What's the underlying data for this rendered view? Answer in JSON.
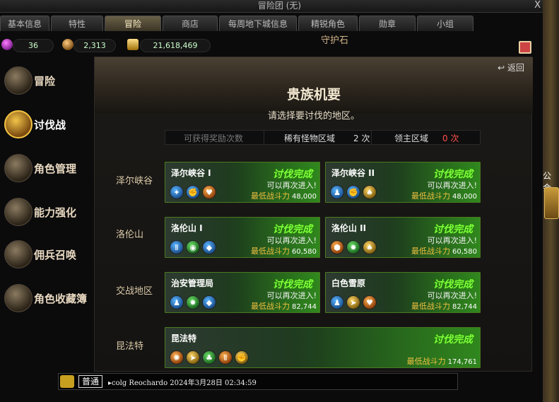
{
  "window": {
    "title": "冒险团 (无)",
    "close": "X"
  },
  "tabs": [
    "基本信息",
    "特性",
    "冒险",
    "商店",
    "每周地下城信息",
    "精锐角色",
    "勋章",
    "小组"
  ],
  "active_tab": 2,
  "currency": {
    "gems": "36",
    "coins": "2,313",
    "gold": "21,618,469"
  },
  "guardian_text": "守护石",
  "sidebar": [
    {
      "label": "冒险"
    },
    {
      "label": "讨伐战"
    },
    {
      "label": "角色管理"
    },
    {
      "label": "能力强化"
    },
    {
      "label": "佣兵召唤"
    },
    {
      "label": "角色收藏簿"
    }
  ],
  "right_strip_text": "公会",
  "main": {
    "back": "返回",
    "title": "贵族机要",
    "subtitle": "请选择要讨伐的地区。",
    "stats": {
      "reward_label": "可获得奖励次数",
      "rare_label": "稀有怪物区域",
      "rare_count": "2 次",
      "boss_label": "领主区域",
      "boss_count": "0 次"
    },
    "regions": [
      {
        "name": "泽尔峡谷"
      },
      {
        "name": "洛伦山"
      },
      {
        "name": "交战地区"
      },
      {
        "name": "昆法特"
      }
    ],
    "cards": [
      {
        "name": "泽尔峡谷 I",
        "status": "讨伐完成",
        "reenter": "可以再次进入!",
        "power_label": "最低战斗力",
        "power": "48,000",
        "icons": [
          "blue",
          "blue",
          "orange"
        ]
      },
      {
        "name": "泽尔峡谷 II",
        "status": "讨伐完成",
        "reenter": "可以再次进入!",
        "power_label": "最低战斗力",
        "power": "48,000",
        "icons": [
          "blue",
          "blue",
          "gold"
        ]
      },
      {
        "name": "洛伦山 I",
        "status": "讨伐完成",
        "reenter": "可以再次进入!",
        "power_label": "最低战斗力",
        "power": "60,580",
        "icons": [
          "blue",
          "green",
          "blue"
        ]
      },
      {
        "name": "洛伦山 II",
        "status": "讨伐完成",
        "reenter": "可以再次进入!",
        "power_label": "最低战斗力",
        "power": "60,580",
        "icons": [
          "orange",
          "green",
          "gold"
        ]
      },
      {
        "name": "治安管理局",
        "status": "讨伐完成",
        "reenter": "可以再次进入!",
        "power_label": "最低战斗力",
        "power": "82,744",
        "icons": [
          "blue",
          "green",
          "blue"
        ]
      },
      {
        "name": "白色雪原",
        "status": "讨伐完成",
        "reenter": "可以再次进入!",
        "power_label": "最低战斗力",
        "power": "82,744",
        "icons": [
          "blue",
          "gold",
          "orange"
        ]
      },
      {
        "name": "昆法特",
        "status": "讨伐完成",
        "reenter": "",
        "power_label": "最低战斗力",
        "power": "174,761",
        "icons": [
          "orange",
          "gold",
          "green",
          "orange",
          "gold"
        ]
      }
    ]
  },
  "chat": {
    "mode": "普通",
    "message": "colg Reochardo 2024年3月28日 02:34:59"
  }
}
